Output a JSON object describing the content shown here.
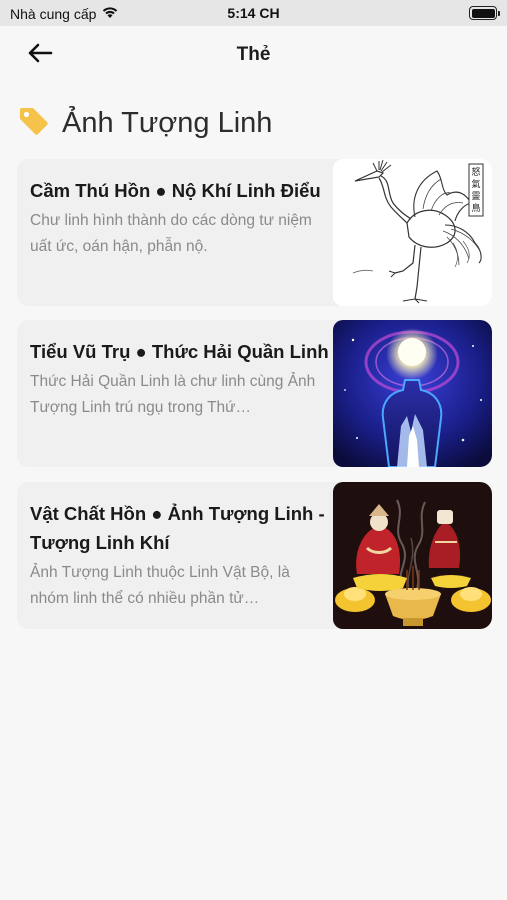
{
  "status_bar": {
    "carrier": "Nhà cung cấp",
    "time": "5:14 CH"
  },
  "nav": {
    "title": "Thẻ",
    "back_icon": "arrow-left-icon"
  },
  "section": {
    "icon": "tag-icon",
    "icon_color": "#f5c24a",
    "title": "Ảnh Tượng Linh"
  },
  "cards": [
    {
      "title": "Cầm Thú Hồn ● Nộ Khí Linh Điểu",
      "description": "Chư linh hình thành do các dòng tư niệm uất ức, oán hận, phẫn nộ.",
      "image": "crane-sketch",
      "seal_text": "怒氣靈鳥"
    },
    {
      "title": "Tiểu Vũ Trụ ● Thức Hải Quần Linh",
      "description": "Thức Hải Quần Linh là chư linh cùng Ảnh Tượng Linh trú ngụ trong Thứ…",
      "image": "cosmic-silhouette"
    },
    {
      "title": "Vật Chất Hồn ● Ảnh Tượng Linh - Tượng Linh Khí",
      "description": "Ảnh Tượng Linh thuộc Linh Vật Bộ, là nhóm linh thể có nhiều phần tử…",
      "image": "incense-offering"
    }
  ]
}
